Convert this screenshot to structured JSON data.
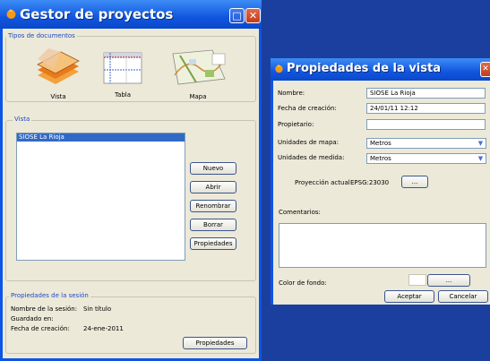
{
  "manager": {
    "title": "Gestor de proyectos",
    "doc_types_label": "Tipos de documentos",
    "doc_types": [
      "Vista",
      "Tabla",
      "Mapa"
    ],
    "view_section_label": "Vista",
    "views": [
      "SIOSE La Rioja"
    ],
    "buttons": {
      "new": "Nuevo",
      "open": "Abrir",
      "rename": "Renombrar",
      "delete": "Borrar",
      "properties": "Propiedades"
    },
    "session": {
      "label": "Propiedades de la sesión",
      "name_label": "Nombre de la sesión:",
      "name_value": "Sin título",
      "saved_label": "Guardado en:",
      "saved_value": "",
      "date_label": "Fecha de creación:",
      "date_value": "24-ene-2011",
      "properties_button": "Propiedades"
    }
  },
  "view_props": {
    "title": "Propiedades de la vista",
    "name_label": "Nombre:",
    "name_value": "SIOSE La Rioja",
    "created_label": "Fecha de creación:",
    "created_value": "24/01/11 12:12",
    "owner_label": "Propietario:",
    "owner_value": "",
    "map_units_label": "Unidades de mapa:",
    "map_units_value": "Metros",
    "measure_units_label": "Unidades de medida:",
    "measure_units_value": "Metros",
    "projection_label": "Proyección actual",
    "projection_value": "EPSG:23030",
    "projection_button": "...",
    "comments_label": "Comentarios:",
    "bg_color_label": "Color de fondo:",
    "bg_color_button": "...",
    "accept_button": "Aceptar",
    "cancel_button": "Cancelar"
  },
  "colors": {
    "desktop": "#1a3f9e",
    "titlebar": "#1156de",
    "window_face": "#ece9d8",
    "selection": "#316ac5",
    "group_label": "#1e48c8"
  },
  "icons": [
    "project-app-icon",
    "maximize-icon",
    "close-icon",
    "vista-doc-icon",
    "tabla-doc-icon",
    "mapa-doc-icon",
    "combo-arrow-icon"
  ]
}
